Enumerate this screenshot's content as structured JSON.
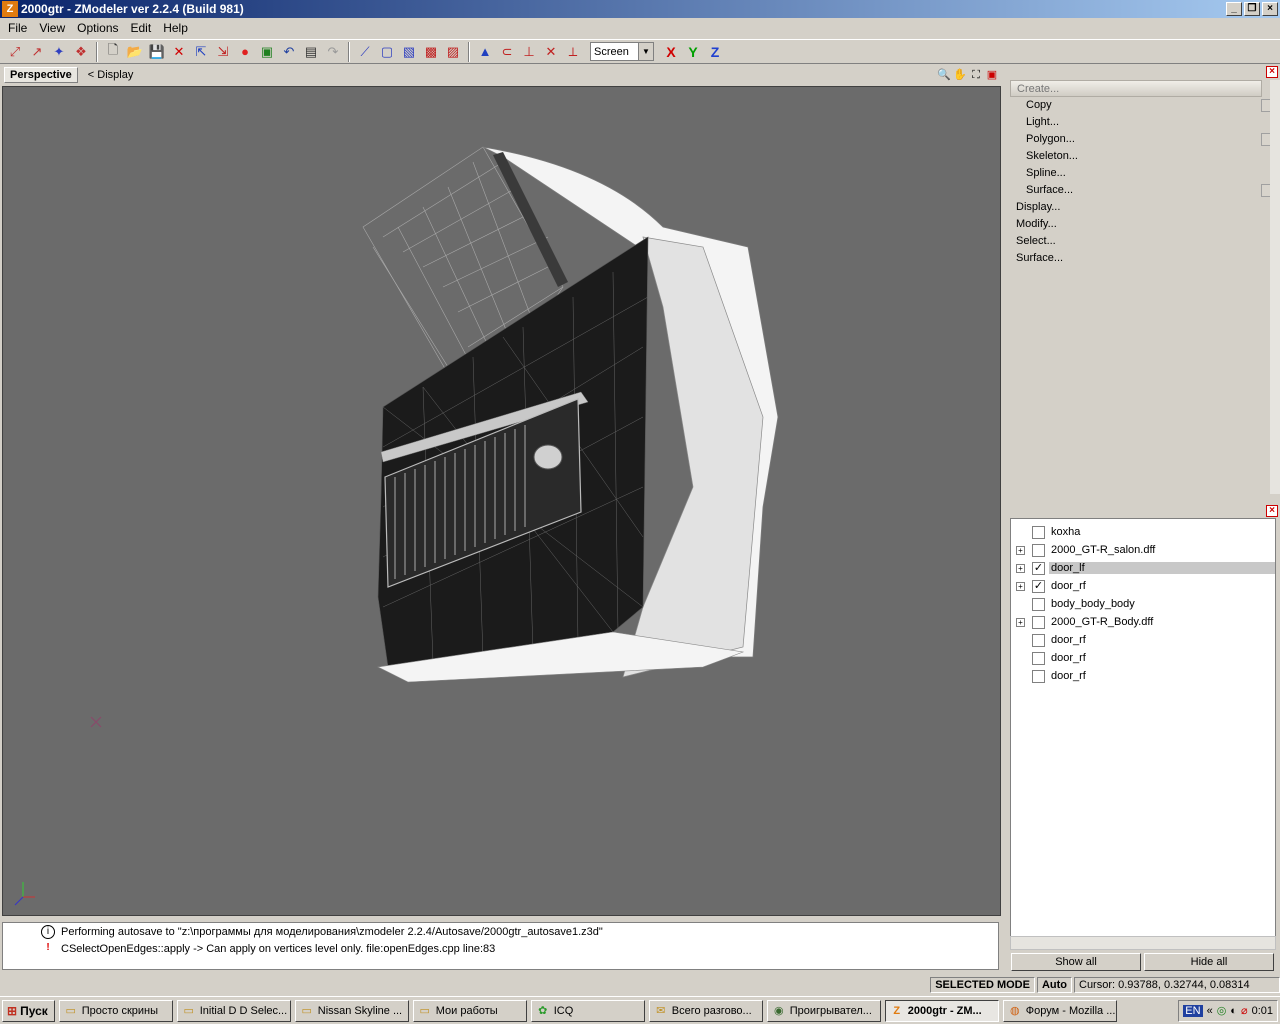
{
  "window": {
    "title": "2000gtr - ZModeler ver 2.2.4 (Build 981)",
    "app_icon": "Z"
  },
  "menu": [
    "File",
    "View",
    "Options",
    "Edit",
    "Help"
  ],
  "toolbar": {
    "view_select": "Screen",
    "axes": [
      "X",
      "Y",
      "Z"
    ]
  },
  "viewport": {
    "tab": "Perspective",
    "crumb": "<  Display"
  },
  "right_panel": {
    "header": "Create...",
    "items": [
      {
        "label": "Copy",
        "sub": true,
        "checkbox": true
      },
      {
        "label": "Light...",
        "sub": true,
        "checkbox": false
      },
      {
        "label": "Polygon...",
        "sub": true,
        "checkbox": true
      },
      {
        "label": "Skeleton...",
        "sub": true,
        "checkbox": false
      },
      {
        "label": "Spline...",
        "sub": true,
        "checkbox": false
      },
      {
        "label": "Surface...",
        "sub": true,
        "checkbox": true
      },
      {
        "label": "Display...",
        "sub": false,
        "checkbox": false
      },
      {
        "label": "Modify...",
        "sub": false,
        "checkbox": false
      },
      {
        "label": "Select...",
        "sub": false,
        "checkbox": false
      },
      {
        "label": "Surface...",
        "sub": false,
        "checkbox": false
      }
    ]
  },
  "tree": {
    "items": [
      {
        "label": "koxha",
        "expandable": false,
        "checked": false,
        "selected": false
      },
      {
        "label": "2000_GT-R_salon.dff",
        "expandable": true,
        "checked": false,
        "selected": false
      },
      {
        "label": "door_lf",
        "expandable": true,
        "checked": true,
        "selected": true
      },
      {
        "label": "door_rf",
        "expandable": true,
        "checked": true,
        "selected": false
      },
      {
        "label": "body_body_body",
        "expandable": false,
        "checked": false,
        "selected": false
      },
      {
        "label": "2000_GT-R_Body.dff",
        "expandable": true,
        "checked": false,
        "selected": false
      },
      {
        "label": "door_rf",
        "expandable": false,
        "checked": false,
        "selected": false
      },
      {
        "label": "door_rf",
        "expandable": false,
        "checked": false,
        "selected": false
      },
      {
        "label": "door_rf",
        "expandable": false,
        "checked": false,
        "selected": false
      }
    ],
    "show_all": "Show all",
    "hide_all": "Hide all"
  },
  "log": [
    {
      "icon": "info-icon",
      "text": "Performing autosave to \"z:\\программы для моделирования\\zmodeler 2.2.4/Autosave/2000gtr_autosave1.z3d\""
    },
    {
      "icon": "error-icon",
      "text": "CSelectOpenEdges::apply -> Can apply on vertices level only. file:openEdges.cpp line:83"
    }
  ],
  "status": {
    "mode": "SELECTED MODE",
    "auto": "Auto",
    "cursor": "Cursor: 0.93788, 0.32744, 0.08314"
  },
  "taskbar": {
    "start": "Пуск",
    "tasks": [
      {
        "label": "Просто скрины",
        "active": false
      },
      {
        "label": "Initial D D Selec...",
        "active": false
      },
      {
        "label": "Nissan Skyline ...",
        "active": false
      },
      {
        "label": "Мои работы",
        "active": false
      },
      {
        "label": "ICQ",
        "active": false
      },
      {
        "label": "Всего разгово...",
        "active": false
      },
      {
        "label": "Проигрывател...",
        "active": false
      },
      {
        "label": "2000gtr - ZM...",
        "active": true
      },
      {
        "label": "Форум - Mozilla ...",
        "active": false
      }
    ],
    "lang": "EN",
    "clock": "0:01"
  }
}
